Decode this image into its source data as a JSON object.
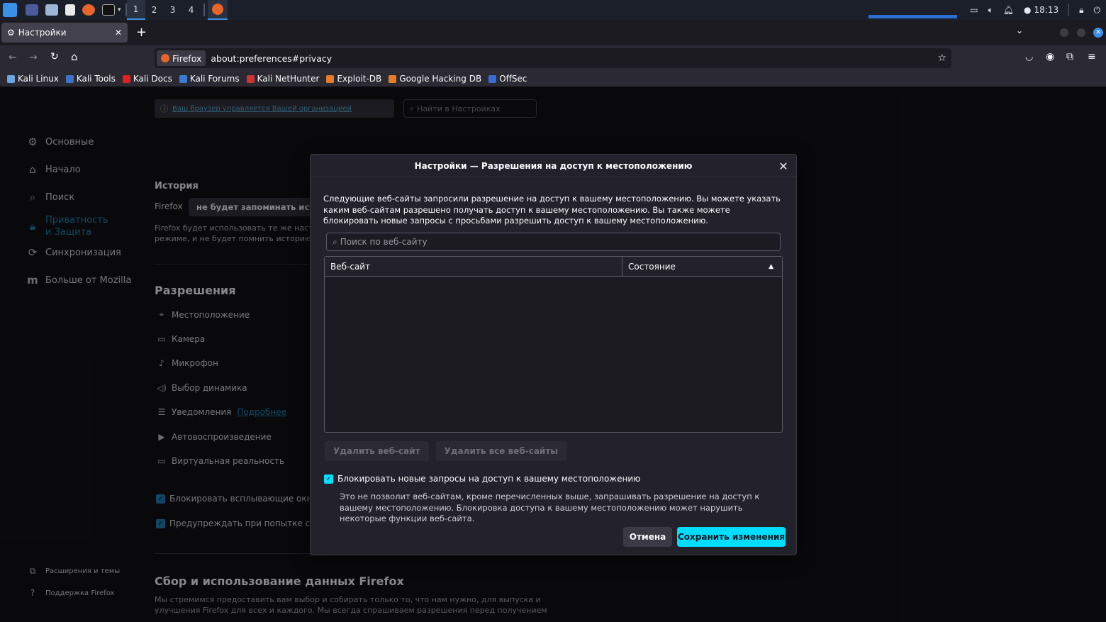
{
  "taskbar": {
    "workspaces": [
      "1",
      "2",
      "3",
      "4"
    ],
    "clock": "18:13"
  },
  "browser": {
    "tab_title": "Настройки",
    "url_identity": "Firefox",
    "url": "about:preferences#privacy",
    "bookmarks": [
      "Kali Linux",
      "Kali Tools",
      "Kali Docs",
      "Kali Forums",
      "Kali NetHunter",
      "Exploit-DB",
      "Google Hacking DB",
      "OffSec"
    ]
  },
  "prefs": {
    "managed_notice": "Ваш браузер управляется Вашей организацией",
    "search_placeholder": "Найти в Настройках",
    "sidebar": [
      {
        "label": "Основные",
        "icon": "gear-icon"
      },
      {
        "label": "Начало",
        "icon": "home-icon"
      },
      {
        "label": "Поиск",
        "icon": "search-icon"
      },
      {
        "label": "Приватность и Защита",
        "icon": "lock-icon"
      },
      {
        "label": "Синхронизация",
        "icon": "sync-icon"
      },
      {
        "label": "Больше от Mozilla",
        "icon": "mozilla-icon"
      }
    ],
    "sidebar_footer": [
      "Расширения и темы",
      "Поддержка Firefox"
    ],
    "history": {
      "heading": "История",
      "firefox_label": "Firefox",
      "select_value": "не будет запоминать истори",
      "desc_line1": "Firefox будет использовать те же настр",
      "desc_line2": "режиме, и не будет помнить историю в"
    },
    "permissions": {
      "heading": "Разрешения",
      "items": [
        "Местоположение",
        "Камера",
        "Микрофон",
        "Выбор динамика",
        "Уведомления",
        "Автовоспроизведение",
        "Виртуальная реальность"
      ],
      "notifications_link": "Подробнее",
      "block_popups": "Блокировать всплывающие окна",
      "warn_addons": "Предупреждать при попытке сайто"
    },
    "data_collection": {
      "heading": "Сбор и использование данных Firefox",
      "line1": "Мы стремимся предоставить вам выбор и собирать только то, что нам нужно, для выпуска и",
      "line2": "улучшения Firefox для всех и каждого. Мы всегда спрашиваем разрешения перед получением"
    }
  },
  "dialog": {
    "title": "Настройки — Разрешения на доступ к местоположению",
    "description": "Следующие веб-сайты запросили разрешение на доступ к вашему местоположению. Вы можете указать каким веб-сайтам разрешено получать доступ к вашему местоположению. Вы также можете блокировать новые запросы с просьбами разрешить доступ к вашему местоположению.",
    "search_placeholder": "Поиск по веб-сайту",
    "col_site": "Веб-сайт",
    "col_status": "Состояние",
    "remove_site": "Удалить веб-сайт",
    "remove_all": "Удалить все веб-сайты",
    "block_label": "Блокировать новые запросы на доступ к вашему местоположению",
    "block_desc": "Это не позволит веб-сайтам, кроме перечисленных выше, запрашивать разрешение на доступ к вашему местоположению. Блокировка доступа к вашему местоположению может нарушить некоторые функции веб-сайта.",
    "cancel": "Отмена",
    "save": "Сохранить изменения"
  }
}
